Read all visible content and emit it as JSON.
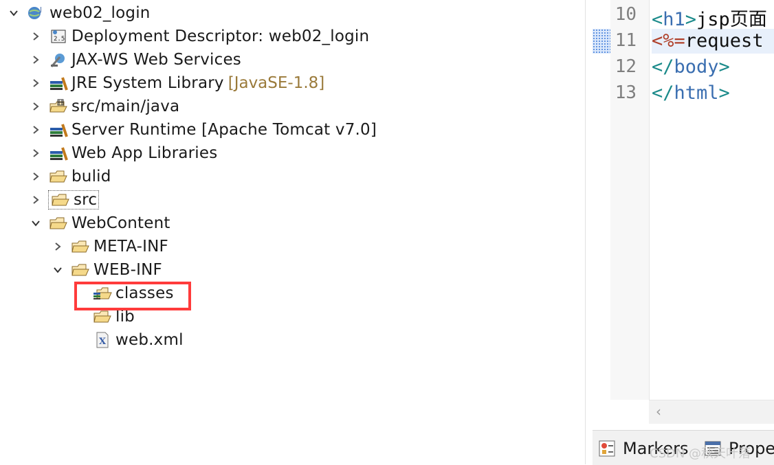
{
  "explorer": {
    "project": {
      "label": "web02_login"
    },
    "items": [
      {
        "label": "Deployment Descriptor: web02_login",
        "icon": "deployment-descriptor-icon"
      },
      {
        "label": "JAX-WS Web Services",
        "icon": "web-services-icon"
      },
      {
        "label": "JRE System Library",
        "decoration": "[JavaSE-1.8]",
        "icon": "library-icon"
      },
      {
        "label": "src/main/java",
        "icon": "source-folder-icon"
      },
      {
        "label": "Server Runtime [Apache Tomcat v7.0]",
        "icon": "library-icon"
      },
      {
        "label": "Web App Libraries",
        "icon": "library-icon"
      },
      {
        "label": "bulid",
        "icon": "folder-icon"
      },
      {
        "label": "src",
        "icon": "folder-icon"
      },
      {
        "label": "WebContent",
        "icon": "folder-icon"
      },
      {
        "label": "META-INF",
        "icon": "folder-icon"
      },
      {
        "label": "WEB-INF",
        "icon": "folder-icon"
      },
      {
        "label": "classes",
        "icon": "classes-folder-icon"
      },
      {
        "label": "lib",
        "icon": "folder-icon"
      },
      {
        "label": "web.xml",
        "icon": "xml-file-icon"
      }
    ],
    "highlight_color": "#ff3b3b"
  },
  "editor": {
    "lines": [
      {
        "num": "10",
        "code_parts": [
          "<",
          "h1",
          ">",
          "jsp页面"
        ]
      },
      {
        "num": "11",
        "code_parts": [
          "<%=",
          "request"
        ]
      },
      {
        "num": "12",
        "code_parts": [
          "</",
          "body",
          ">"
        ]
      },
      {
        "num": "13",
        "code_parts": [
          "</",
          "html",
          ">"
        ]
      }
    ]
  },
  "bottom_tabs": {
    "markers": "Markers",
    "properties": "Prope"
  },
  "watermark": "CSDN @秋天叶落"
}
